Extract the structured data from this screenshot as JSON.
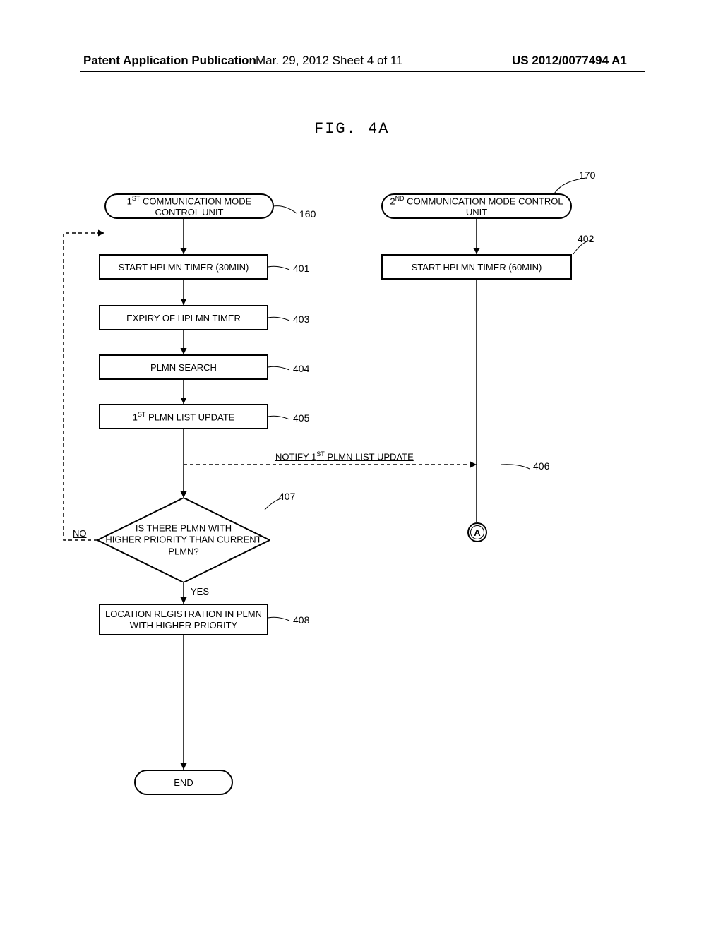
{
  "header": {
    "left": "Patent Application Publication",
    "center": "Mar. 29, 2012  Sheet 4 of 11",
    "right": "US 2012/0077494 A1"
  },
  "figure": {
    "title": "FIG.  4A"
  },
  "refs": {
    "r170": "170",
    "r160": "160",
    "r401": "401",
    "r402": "402",
    "r403": "403",
    "r404": "404",
    "r405": "405",
    "r406": "406",
    "r407": "407",
    "r408": "408"
  },
  "labels": {
    "unit1_pre": "1",
    "unit1_sup": "ST",
    "unit1_post": " COMMUNICATION MODE CONTROL UNIT",
    "unit2_pre": "2",
    "unit2_sup": "ND",
    "unit2_post": " COMMUNICATION MODE CONTROL UNIT",
    "step401": "START HPLMN TIMER (30MIN)",
    "step402": "START HPLMN TIMER (60MIN)",
    "step403": "EXPIRY OF HPLMN TIMER",
    "step404": "PLMN SEARCH",
    "step405_pre": "1",
    "step405_sup": "ST",
    "step405_post": " PLMN LIST UPDATE",
    "msg406_pre": "NOTIFY 1",
    "msg406_sup": "ST",
    "msg406_post": " PLMN LIST UPDATE",
    "decision407_l1": "IS THERE PLMN WITH",
    "decision407_l2": "HIGHER PRIORITY THAN CURRENT",
    "decision407_l3": "PLMN?",
    "no": "NO",
    "yes": "YES",
    "step408_l1": "LOCATION REGISTRATION IN PLMN",
    "step408_l2": "WITH HIGHER PRIORITY",
    "end": "END",
    "connector": "A"
  }
}
